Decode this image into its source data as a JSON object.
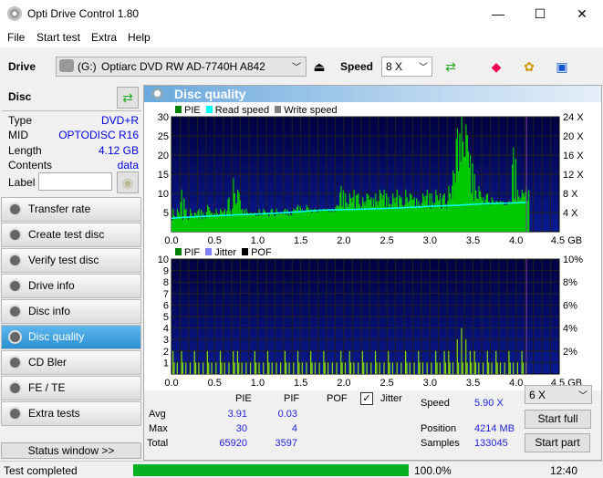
{
  "window": {
    "title": "Opti Drive Control 1.80",
    "minimize": "—",
    "maximize": "☐",
    "close": "✕"
  },
  "menu": [
    "File",
    "Start test",
    "Extra",
    "Help"
  ],
  "toolbar": {
    "drive_label": "Drive",
    "drive_letter": "(G:)",
    "drive_name": "Optiarc DVD RW AD-7740H A842",
    "speed_label": "Speed",
    "speed_value": "8 X"
  },
  "disc": {
    "title": "Disc",
    "rows": [
      {
        "label": "Type",
        "value": "DVD+R"
      },
      {
        "label": "MID",
        "value": "OPTODISC R16"
      },
      {
        "label": "Length",
        "value": "4.12 GB"
      },
      {
        "label": "Contents",
        "value": "data"
      }
    ],
    "label_field": "Label",
    "label_value": ""
  },
  "nav": [
    "Transfer rate",
    "Create test disc",
    "Verify test disc",
    "Drive info",
    "Disc info",
    "Disc quality",
    "CD Bler",
    "FE / TE",
    "Extra tests"
  ],
  "nav_active": "Disc quality",
  "status_window": "Status window >>",
  "panel_title": "Disc quality",
  "colors": {
    "pie": "#00c800",
    "pif": "#88e000",
    "read": "#00ffff",
    "plot_top": "#000040",
    "plot_bottom": "#0a1a90",
    "accent": "#2b8fd3",
    "progress": "#06b025"
  },
  "chart_data": [
    {
      "type": "bar",
      "legend": [
        "PIE",
        "Read speed",
        "Write speed"
      ],
      "legend_colors": [
        "#008000",
        "#00ffff",
        "#808080"
      ],
      "xlim": [
        0,
        4.5
      ],
      "ylim": [
        0,
        30
      ],
      "y2lim": [
        0,
        24
      ],
      "grid": true,
      "xticks": [
        "0.0",
        "0.5",
        "1.0",
        "1.5",
        "2.0",
        "2.5",
        "3.0",
        "3.5",
        "4.0",
        "4.5 GB"
      ],
      "yticks": [
        "5",
        "10",
        "15",
        "20",
        "25",
        "30"
      ],
      "y2ticks": [
        "4 X",
        "8 X",
        "12 X",
        "16 X",
        "20 X",
        "24 X"
      ],
      "bin_gb": 0.05,
      "pie": [
        6,
        6,
        11,
        6,
        6,
        5,
        6,
        5,
        7,
        5,
        6,
        6,
        6,
        9,
        14,
        11,
        6,
        6,
        5,
        5,
        6,
        6,
        5,
        6,
        6,
        5,
        6,
        5,
        6,
        7,
        6,
        7,
        6,
        6,
        6,
        6,
        6,
        6,
        7,
        12,
        10,
        10,
        11,
        10,
        9,
        10,
        9,
        10,
        11,
        11,
        9,
        10,
        11,
        9,
        11,
        10,
        9,
        8,
        10,
        11,
        10,
        11,
        10,
        10,
        12,
        16,
        27,
        30,
        28,
        20,
        15,
        12,
        9,
        10,
        9,
        8,
        8,
        7,
        8,
        22,
        11,
        11,
        12
      ],
      "pie_base": [
        3,
        3,
        3,
        3,
        3,
        3,
        3,
        3,
        4,
        4,
        4,
        4,
        4,
        4,
        4,
        4,
        4,
        4,
        4,
        4,
        4,
        4,
        4,
        4,
        4,
        4,
        4,
        4,
        5,
        5,
        5,
        5,
        5,
        5,
        5,
        5,
        5,
        5,
        6,
        6,
        6,
        6,
        6,
        6,
        6,
        6,
        6,
        6,
        6,
        6,
        6,
        6,
        6,
        6,
        6,
        6,
        6,
        6,
        6,
        6,
        6,
        6,
        6,
        6,
        7,
        8,
        13,
        17,
        14,
        9,
        8,
        7,
        7,
        7,
        7,
        7,
        7,
        7,
        7,
        7,
        8,
        8,
        8
      ],
      "read_speed": [
        [
          0,
          2.8
        ],
        [
          0.15,
          3.0
        ],
        [
          0.5,
          3.3
        ],
        [
          0.85,
          3.6
        ],
        [
          1.25,
          3.9
        ],
        [
          1.5,
          4.2
        ],
        [
          1.75,
          4.5
        ],
        [
          2.2,
          4.7
        ],
        [
          2.7,
          5.0
        ],
        [
          3.0,
          5.3
        ],
        [
          3.3,
          5.5
        ],
        [
          3.6,
          5.8
        ],
        [
          4.12,
          6.1
        ]
      ]
    },
    {
      "type": "bar",
      "legend": [
        "PIF",
        "Jitter",
        "POF"
      ],
      "legend_colors": [
        "#008000",
        "#8080ff",
        "#000000"
      ],
      "xlim": [
        0,
        4.5
      ],
      "ylim": [
        0,
        10
      ],
      "y2lim": [
        0,
        10
      ],
      "grid": true,
      "xticks": [
        "0.0",
        "0.5",
        "1.0",
        "1.5",
        "2.0",
        "2.5",
        "3.0",
        "3.5",
        "4.0",
        "4.5 GB"
      ],
      "yticks": [
        "1",
        "2",
        "3",
        "4",
        "5",
        "6",
        "7",
        "8",
        "9",
        "10"
      ],
      "y2ticks": [
        "2%",
        "4%",
        "6%",
        "8%",
        "10%"
      ],
      "bin_gb": 0.05,
      "pif": [
        2,
        1,
        2,
        1,
        1,
        2,
        1,
        1,
        2,
        1,
        1,
        2,
        1,
        1,
        2,
        2,
        1,
        1,
        1,
        2,
        1,
        1,
        2,
        1,
        1,
        1,
        2,
        1,
        1,
        2,
        1,
        1,
        2,
        1,
        1,
        2,
        1,
        1,
        1,
        2,
        1,
        2,
        1,
        1,
        2,
        1,
        1,
        2,
        1,
        1,
        2,
        1,
        1,
        1,
        2,
        1,
        1,
        2,
        1,
        1,
        1,
        2,
        1,
        2,
        2,
        1,
        3,
        4,
        3,
        2,
        2,
        1,
        1,
        2,
        1,
        2,
        1,
        1,
        2,
        1,
        1,
        2,
        1
      ]
    }
  ],
  "stats": {
    "headers": [
      "PIE",
      "PIF",
      "POF"
    ],
    "jitter_label": "Jitter",
    "jitter_checked": true,
    "rows": [
      {
        "label": "Avg",
        "pie": "3.91",
        "pif": "0.03"
      },
      {
        "label": "Max",
        "pie": "30",
        "pif": "4"
      },
      {
        "label": "Total",
        "pie": "65920",
        "pif": "3597"
      }
    ],
    "speed_label": "Speed",
    "speed_value": "5.90 X",
    "position_label": "Position",
    "position_value": "4214 MB",
    "samples_label": "Samples",
    "samples_value": "133045",
    "speed_select": "6 X",
    "start_full": "Start full",
    "start_part": "Start part"
  },
  "status": {
    "text": "Test completed",
    "progress": 100,
    "progress_text": "100.0%",
    "time": "12:40"
  }
}
